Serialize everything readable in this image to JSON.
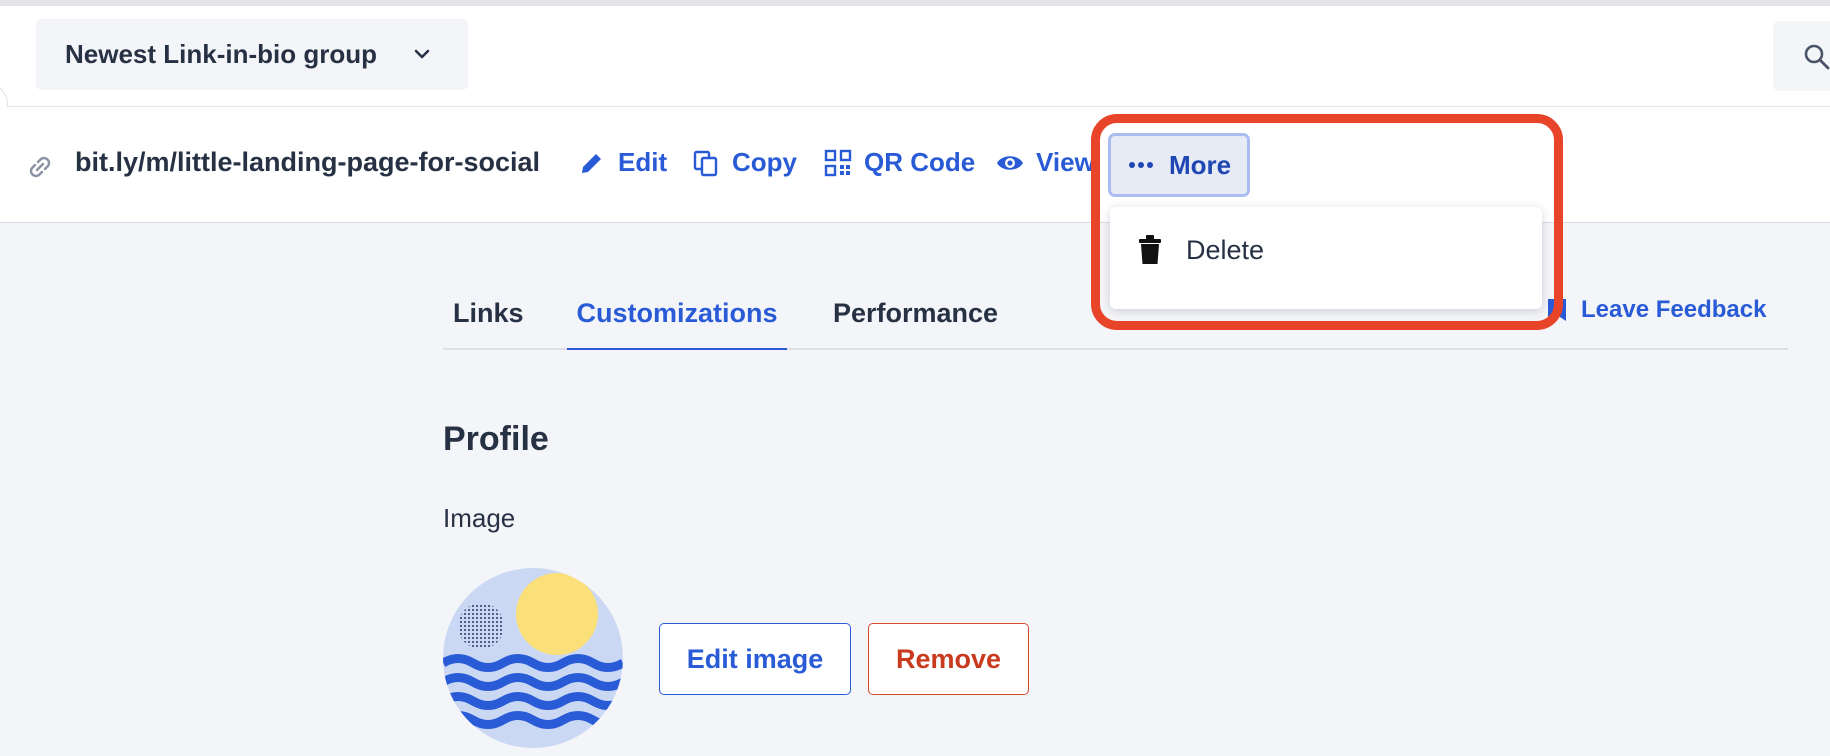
{
  "header": {
    "group_name": "Newest Link-in-bio group",
    "icons": {
      "dropdown": "chevron-down-icon",
      "search": "search-icon"
    }
  },
  "link_bar": {
    "short_link": "bit.ly/m/little-landing-page-for-social",
    "actions": {
      "edit": "Edit",
      "copy": "Copy",
      "qr_code": "QR Code",
      "view": "View",
      "more": "More"
    }
  },
  "more_menu": {
    "items": [
      {
        "label": "Delete",
        "icon": "trash-icon"
      }
    ]
  },
  "tabs": [
    {
      "label": "Links",
      "active": false
    },
    {
      "label": "Customizations",
      "active": true
    },
    {
      "label": "Performance",
      "active": false
    }
  ],
  "feedback": {
    "label": "Leave Feedback"
  },
  "profile": {
    "title": "Profile",
    "image_label": "Image",
    "buttons": {
      "edit_image": "Edit image",
      "remove": "Remove"
    }
  },
  "colors": {
    "accent": "#2a5bd7",
    "danger": "#c93a1f",
    "highlight": "#e8442a",
    "background": "#f4f5f9"
  }
}
